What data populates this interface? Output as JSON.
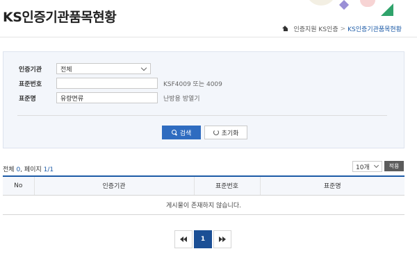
{
  "page": {
    "title": "KS인증기관품목현황"
  },
  "breadcrumb": {
    "items": [
      "인증지원 KS인증",
      "KS인증기관품목현황"
    ],
    "separator": ">"
  },
  "search": {
    "fields": [
      {
        "label": "인증기관",
        "value": "전체",
        "type": "select"
      },
      {
        "label": "표준번호",
        "value": "",
        "hint": "KSF4009 또는 4009",
        "type": "text"
      },
      {
        "label": "표준명",
        "value": "유량면류",
        "hint": "난방용 방열기",
        "type": "text"
      }
    ],
    "search_button": "검색",
    "reset_button": "초기화"
  },
  "results": {
    "total_label": "전체",
    "total": "0",
    "page_label": "페이지",
    "page": "1/1",
    "per_page": "10개",
    "apply_button": "적용"
  },
  "table": {
    "columns": [
      "No",
      "인증기관",
      "표준번호",
      "표준명"
    ],
    "empty_message": "게시물이 존재하지 않습니다."
  },
  "pagination": {
    "current": "1"
  },
  "colors": {
    "accent": "#1b5aa6",
    "search_button": "#2f6cc0",
    "search_bg": "#f3f6fb"
  }
}
